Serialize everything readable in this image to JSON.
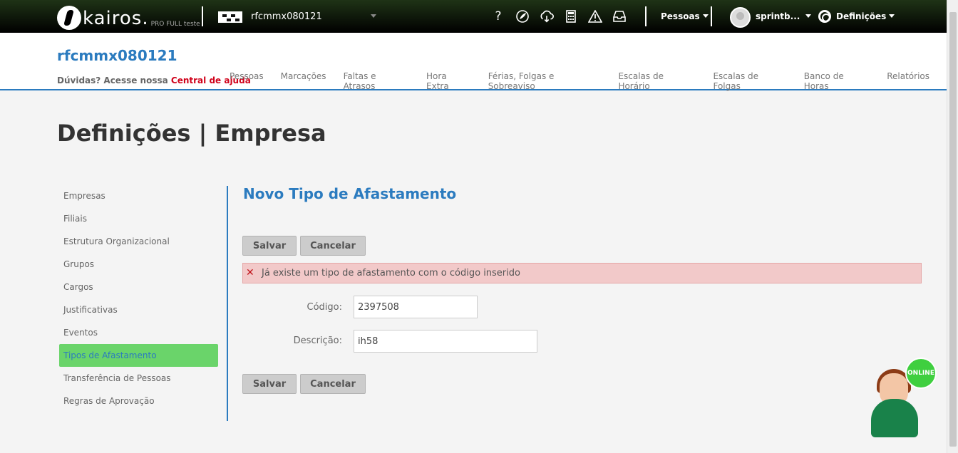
{
  "topbar": {
    "logo_text": "kairos.",
    "logo_sub": "PRO FULL teste",
    "company": "rfcmmx080121",
    "icons": [
      "help-icon",
      "leaf-icon",
      "cloud-download-icon",
      "calculator-icon",
      "warning-icon",
      "inbox-icon"
    ],
    "help_glyph": "?",
    "pessoas_label": "Pessoas",
    "user_label": "sprintb...",
    "definicoes_label": "Definições"
  },
  "header": {
    "company_title": "rfcmmx080121",
    "help_text": "Dúvidas? Acesse nossa",
    "help_link": "Central de ajuda",
    "nav": [
      "Pessoas",
      "Marcações",
      "Faltas e Atrasos",
      "Hora Extra",
      "Férias, Folgas e Sobreaviso",
      "Escalas de Horário",
      "Escalas de Folgas",
      "Banco de Horas",
      "Relatórios"
    ]
  },
  "page": {
    "title": "Definições | Empresa"
  },
  "sidebar": {
    "items": [
      {
        "label": "Empresas"
      },
      {
        "label": "Filiais"
      },
      {
        "label": "Estrutura Organizacional"
      },
      {
        "label": "Grupos"
      },
      {
        "label": "Cargos"
      },
      {
        "label": "Justificativas"
      },
      {
        "label": "Eventos"
      },
      {
        "label": "Tipos de Afastamento",
        "active": true
      },
      {
        "label": "Transferência de Pessoas"
      },
      {
        "label": "Regras de Aprovação"
      }
    ]
  },
  "form": {
    "title": "Novo Tipo de Afastamento",
    "save_label": "Salvar",
    "cancel_label": "Cancelar",
    "error": "Já existe um tipo de afastamento com o código inserido",
    "codigo_label": "Código:",
    "codigo_value": "2397508",
    "descricao_label": "Descrição:",
    "descricao_value": "ih58"
  },
  "chat": {
    "badge": "ONLINE"
  },
  "colors": {
    "accent": "#2b7bbf",
    "active_item": "#6ad46a",
    "error_bg": "#f2c9c9",
    "help_link": "#d0021b"
  }
}
